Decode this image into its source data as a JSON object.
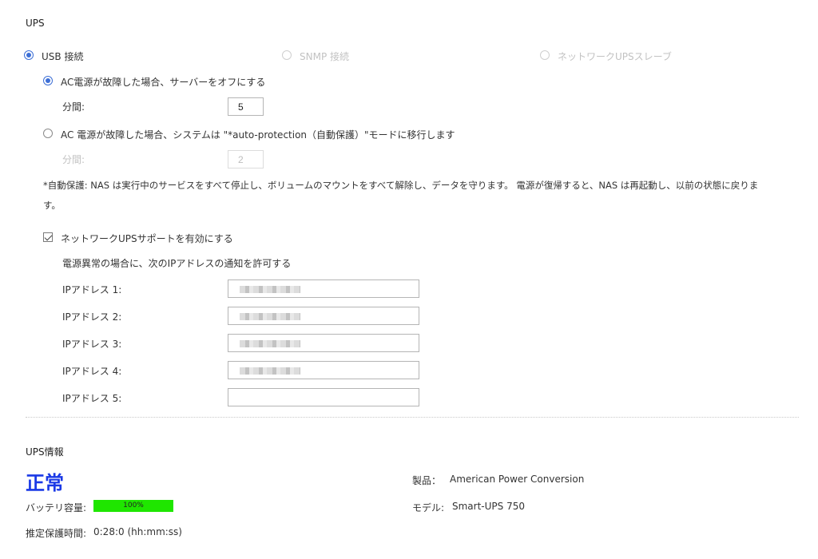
{
  "section_title": "UPS",
  "connection": {
    "usb_label": "USB 接続",
    "snmp_label": "SNMP 接続",
    "network_slave_label": "ネットワークUPSスレーブ",
    "selected": "usb"
  },
  "ac_fail_off": {
    "label": "AC電源が故障した場合、サーバーをオフにする",
    "minutes_label": "分間:",
    "minutes_value": "5"
  },
  "ac_fail_protect": {
    "label": "AC 電源が故障した場合、システムは \"*auto-protection（自動保護）\"モードに移行します",
    "minutes_label": "分間:",
    "minutes_value": "2"
  },
  "note_line1": "*自動保護: NAS は実行中のサービスをすべて停止し、ボリュームのマウントをすべて解除し、データを守ります。 電源が復帰すると、NAS は再起動し、以前の状態に戻りま",
  "note_line2": "す。",
  "network_ups": {
    "checkbox_label": "ネットワークUPSサポートを有効にする",
    "checked": true,
    "allow_label": "電源異常の場合に、次のIPアドレスの通知を許可する",
    "ip_fields": [
      {
        "label": "IPアドレス 1:",
        "value": "",
        "masked": true
      },
      {
        "label": "IPアドレス 2:",
        "value": "",
        "masked": true
      },
      {
        "label": "IPアドレス 3:",
        "value": "",
        "masked": true
      },
      {
        "label": "IPアドレス 4:",
        "value": "",
        "masked": true
      },
      {
        "label": "IPアドレス 5:",
        "value": "",
        "masked": false
      }
    ]
  },
  "ups_info": {
    "title": "UPS情報",
    "status": "正常",
    "status_color": "#1a39e6",
    "battery_label": "バッテリ容量:",
    "battery_text": "100%",
    "battery_percent": 100,
    "battery_color": "#1fe600",
    "runtime_label": "推定保護時間:",
    "runtime_value": "0:28:0 (hh:mm:ss)",
    "product_label": "製品：",
    "product_value": "American Power Conversion",
    "model_label": "モデル:",
    "model_value": "Smart-UPS 750"
  }
}
